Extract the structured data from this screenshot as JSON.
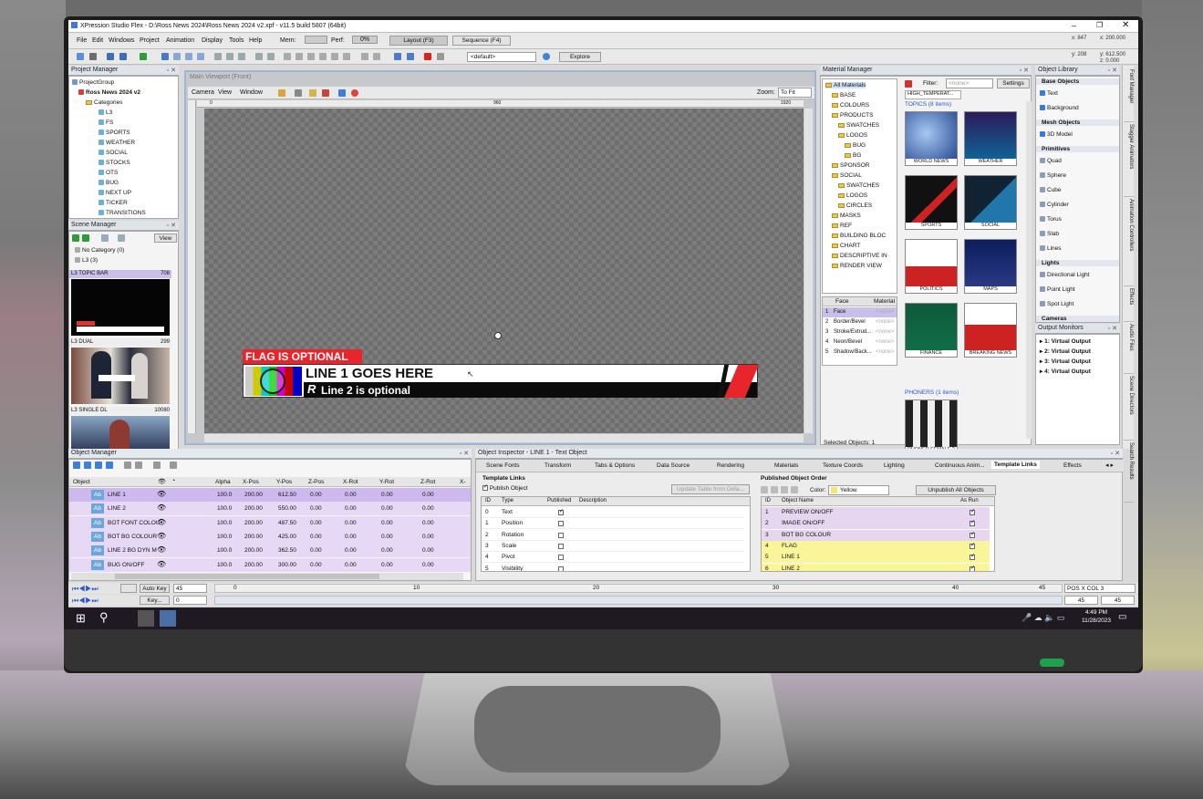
{
  "window": {
    "title": "XPression Studio Flex - D:\\Ross News 2024\\Ross News 2024 v2.xpf - v11.5 build 5807 (64bit)",
    "coords": [
      "x: 847",
      "x: 200.000",
      "y: 208",
      "y: 612.500",
      "z: 0.000"
    ]
  },
  "menu": [
    "File",
    "Edit",
    "Windows",
    "Project",
    "Animation",
    "Display",
    "Tools",
    "Help"
  ],
  "status_meters": {
    "mem_label": "Mem:",
    "perf_label": "Perf:",
    "perf_value": "0%"
  },
  "layout_buttons": [
    "Layout (F3)",
    "Sequence (F4)"
  ],
  "toolbar": {
    "default_select": "<default>",
    "explore_label": "Explore"
  },
  "project_manager": {
    "title": "Project Manager",
    "root": "ProjectGroup",
    "project": "Ross News 2024 v2",
    "categories_label": "Categories",
    "categories": [
      "L3",
      "FS",
      "SPORTS",
      "WEATHER",
      "SOCIAL",
      "STOCKS",
      "OTS",
      "BUG",
      "NEXT UP",
      "TICKER",
      "TRANSITIONS"
    ]
  },
  "scene_manager": {
    "title": "Scene Manager",
    "view_label": "View",
    "no_category": "No Category  (0)",
    "l3": "L3  (3)",
    "scenes": [
      {
        "name": "L3 TOPIC BAR",
        "id": "708"
      },
      {
        "name": "L3 DUAL",
        "id": "299"
      },
      {
        "name": "L3 SINGLE DL",
        "id": "10080"
      }
    ]
  },
  "viewport": {
    "title": "Main Viewport (Front)",
    "menu": [
      "Camera",
      "View",
      "Window"
    ],
    "zoom_label": "Zoom:",
    "zoom_value": "To Fit",
    "ruler_marks": [
      "0",
      "960",
      "1920"
    ],
    "graphic": {
      "flag": "FLAG IS OPTIONAL",
      "line1": "LINE 1 GOES HERE",
      "line2": "Line 2 is optional",
      "logo_letter": "R"
    }
  },
  "material_manager": {
    "title": "Material Manager",
    "filter_label": "Filter:",
    "filter_value": "<none>",
    "settings_label": "Settings",
    "tree": [
      "All Materials",
      "BASE",
      "COLOURS",
      "PRODUCTS",
      "SWATCHES",
      "LOGOS",
      "BUG",
      "BG",
      "SPONSOR",
      "SOCIAL",
      "SWATCHES",
      "LOGOS",
      "CIRCLES",
      "MASKS",
      "REF",
      "BUILDING BLOC",
      "CHART",
      "DESCRIPTIVE IN",
      "RENDER VIEW"
    ],
    "header_tab": "HIGH_TEMPERAT...",
    "topics_label": "TOPICS  (8 items)",
    "phoners_label": "PHONERS  (1 items)",
    "thumbs": [
      "WORLD NEWS",
      "WEATHER",
      "SPORTS",
      "SOCIAL",
      "POLITICS",
      "MAPS",
      "FINANCE",
      "BREAKING NEWS",
      "PHONER FEMALE 2"
    ],
    "face_header": [
      "Face",
      "Material"
    ],
    "faces": [
      "Face",
      "Border/Bevel",
      "Stroke/Extrud...",
      "Neon/Bevel",
      "Shadow/Back..."
    ],
    "face_value": "<none>",
    "selected": "Selected Objects: 1"
  },
  "object_library": {
    "title": "Object Library",
    "sections": [
      {
        "name": "Base Objects",
        "items": [
          "Text",
          "Background"
        ]
      },
      {
        "name": "Mesh Objects",
        "items": [
          "3D Model"
        ]
      },
      {
        "name": "Primitives",
        "items": [
          "Quad",
          "Sphere",
          "Cube",
          "Cylinder",
          "Torus",
          "Slab",
          "Lines"
        ]
      },
      {
        "name": "Lights",
        "items": [
          "Directional Light",
          "Point Light",
          "Spot Light"
        ]
      },
      {
        "name": "Cameras",
        "items": []
      }
    ]
  },
  "output_monitors": {
    "title": "Output Monitors",
    "items": [
      "1: Virtual Output",
      "2: Virtual Output",
      "3: Virtual Output",
      "4: Virtual Output"
    ]
  },
  "side_tabs": [
    "Font Manager",
    "Stagger Animators",
    "Animation Controllers",
    "Effects",
    "Audio Files",
    "Scene Directors",
    "Search Results"
  ],
  "object_manager": {
    "title": "Object Manager",
    "columns": [
      "Object",
      "Alpha",
      "X-Pos",
      "Y-Pos",
      "Z-Pos",
      "X-Rot",
      "Y-Rot",
      "Z-Rot",
      "X-"
    ],
    "rows": [
      {
        "name": "LINE 1",
        "alpha": "100.0",
        "x": "200.00",
        "y": "612.50",
        "z": "0.00",
        "xr": "0.00",
        "yr": "0.00",
        "zr": "0.00"
      },
      {
        "name": "LINE 2",
        "alpha": "100.0",
        "x": "200.00",
        "y": "550.00",
        "z": "0.00",
        "xr": "0.00",
        "yr": "0.00",
        "zr": "0.00"
      },
      {
        "name": "BOT FONT COLOU",
        "alpha": "100.0",
        "x": "200.00",
        "y": "487.50",
        "z": "0.00",
        "xr": "0.00",
        "yr": "0.00",
        "zr": "0.00"
      },
      {
        "name": "BOT BG COLOUR",
        "alpha": "100.0",
        "x": "200.00",
        "y": "425.00",
        "z": "0.00",
        "xr": "0.00",
        "yr": "0.00",
        "zr": "0.00"
      },
      {
        "name": "LINE 2 BG DYN M",
        "alpha": "100.0",
        "x": "200.00",
        "y": "362.50",
        "z": "0.00",
        "xr": "0.00",
        "yr": "0.00",
        "zr": "0.00"
      },
      {
        "name": "BUG ON/OFF",
        "alpha": "100.0",
        "x": "200.00",
        "y": "300.00",
        "z": "0.00",
        "xr": "0.00",
        "yr": "0.00",
        "zr": "0.00"
      }
    ],
    "object_icon": "Ab"
  },
  "inspector": {
    "title": "Object Inspector - LINE 1 - Text Object",
    "tabs": [
      "Scene Fonts",
      "Transform",
      "Tabs & Options",
      "Data Source",
      "Rendering",
      "Materials",
      "Texture Coords",
      "Lighting",
      "Continuous Anim...",
      "Template Links",
      "Effects"
    ],
    "template_links_title": "Template Links",
    "publish_object": "Publish Object",
    "update_button": "Update Table from Defa...",
    "links_columns": [
      "ID",
      "Type",
      "Published",
      "Description"
    ],
    "links": [
      {
        "id": "0",
        "type": "Text",
        "published": true
      },
      {
        "id": "1",
        "type": "Position",
        "published": false
      },
      {
        "id": "2",
        "type": "Rotation",
        "published": false
      },
      {
        "id": "3",
        "type": "Scale",
        "published": false
      },
      {
        "id": "4",
        "type": "Pivot",
        "published": false
      },
      {
        "id": "5",
        "type": "Visibility",
        "published": false
      }
    ],
    "order_title": "Published Object Order",
    "color_label": "Color:",
    "color_value": "Yellow",
    "unpublish_button": "Unpublish All Objects",
    "order_columns": [
      "ID",
      "Object Name",
      "As Run"
    ],
    "order": [
      {
        "id": "1",
        "name": "PREVIEW ON/OFF",
        "color": "#e6d6ef"
      },
      {
        "id": "2",
        "name": "IMAGE ON/OFF",
        "color": "#e6d6ef"
      },
      {
        "id": "3",
        "name": "BOT BG COLOUR",
        "color": "#e6d6ef"
      },
      {
        "id": "4",
        "name": "FLAG",
        "color": "#fbf59a"
      },
      {
        "id": "5",
        "name": "LINE 1",
        "color": "#fbf59a"
      },
      {
        "id": "6",
        "name": "LINE 2",
        "color": "#fbf59a"
      }
    ]
  },
  "timeline": {
    "auto_key": "Auto Key",
    "key": "Key...",
    "frame_a": "45",
    "frame_b": "0",
    "ticks": [
      "0",
      "10",
      "20",
      "30",
      "40",
      "45"
    ],
    "pos_label": "POS X COL 3",
    "end_a": "45",
    "end_b": "45"
  },
  "taskbar": {
    "time": "4:49 PM",
    "date": "11/28/2023"
  },
  "colors": {
    "accent_red": "#e8252b",
    "selection_purple": "#dccaf0",
    "scene_header": "#c9c0ea"
  }
}
